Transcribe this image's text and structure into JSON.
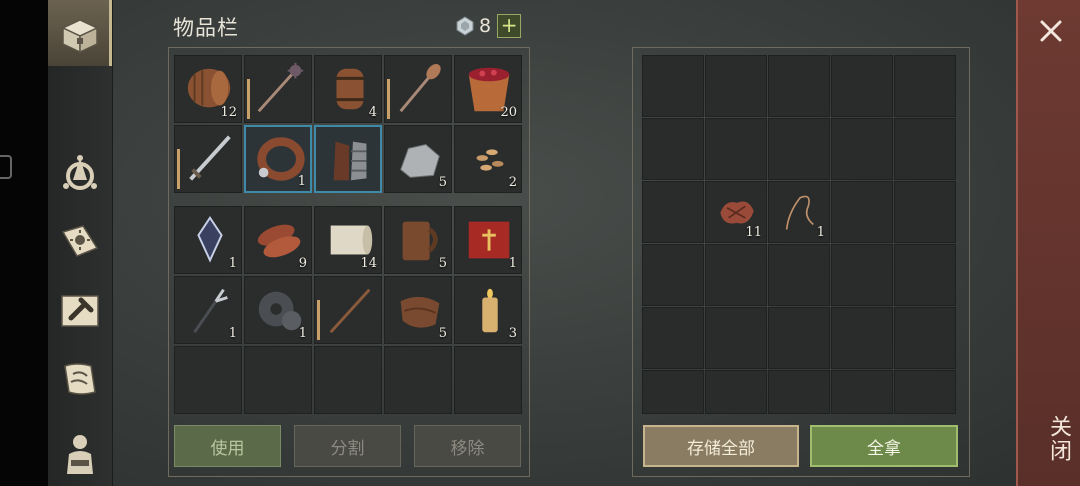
{
  "inventory": {
    "title": "物品栏",
    "currency_count": "8",
    "currency_plus": "+",
    "grid1": [
      {
        "icon": "barrel-icon",
        "qty": "12"
      },
      {
        "icon": "spiked-mace-icon",
        "qty": "",
        "dur": true
      },
      {
        "icon": "keg-icon",
        "qty": "4"
      },
      {
        "icon": "shovel-icon",
        "qty": "",
        "dur": true
      },
      {
        "icon": "berry-bucket-icon",
        "qty": "20"
      },
      {
        "icon": "sword-icon",
        "qty": "",
        "dur": true
      },
      {
        "icon": "collar-icon",
        "qty": "1",
        "selected": true
      },
      {
        "icon": "gloves-icon",
        "qty": "",
        "selected": true
      },
      {
        "icon": "stone-icon",
        "qty": "5"
      },
      {
        "icon": "seeds-icon",
        "qty": "2"
      }
    ],
    "grid2": [
      {
        "icon": "crystal-icon",
        "qty": "1"
      },
      {
        "icon": "meat-icon",
        "qty": "9"
      },
      {
        "icon": "cloth-roll-icon",
        "qty": "14"
      },
      {
        "icon": "mug-icon",
        "qty": "5"
      },
      {
        "icon": "red-book-icon",
        "qty": "1"
      },
      {
        "icon": "fork-icon",
        "qty": "1"
      },
      {
        "icon": "gear-icon",
        "qty": "1"
      },
      {
        "icon": "stick-icon",
        "qty": "",
        "dur": true
      },
      {
        "icon": "leather-icon",
        "qty": "5"
      },
      {
        "icon": "candle-icon",
        "qty": "3"
      },
      {
        "icon": "",
        "qty": ""
      },
      {
        "icon": "",
        "qty": ""
      },
      {
        "icon": "",
        "qty": ""
      },
      {
        "icon": "",
        "qty": ""
      },
      {
        "icon": "",
        "qty": ""
      }
    ],
    "buttons": {
      "use": "使用",
      "split": "分割",
      "remove": "移除"
    }
  },
  "storage": {
    "slots": [
      {
        "row": 2,
        "col": 1,
        "icon": "rawhide-icon",
        "qty": "11"
      },
      {
        "row": 2,
        "col": 2,
        "icon": "rope-icon",
        "qty": "1"
      }
    ],
    "buttons": {
      "store_all": "存储全部",
      "take_all": "全拿"
    }
  },
  "close_label": "关闭",
  "colors": {
    "accent_green": "#6e8a4a",
    "selected_blue": "#3e8aa8",
    "close_red": "#5a2f29"
  }
}
